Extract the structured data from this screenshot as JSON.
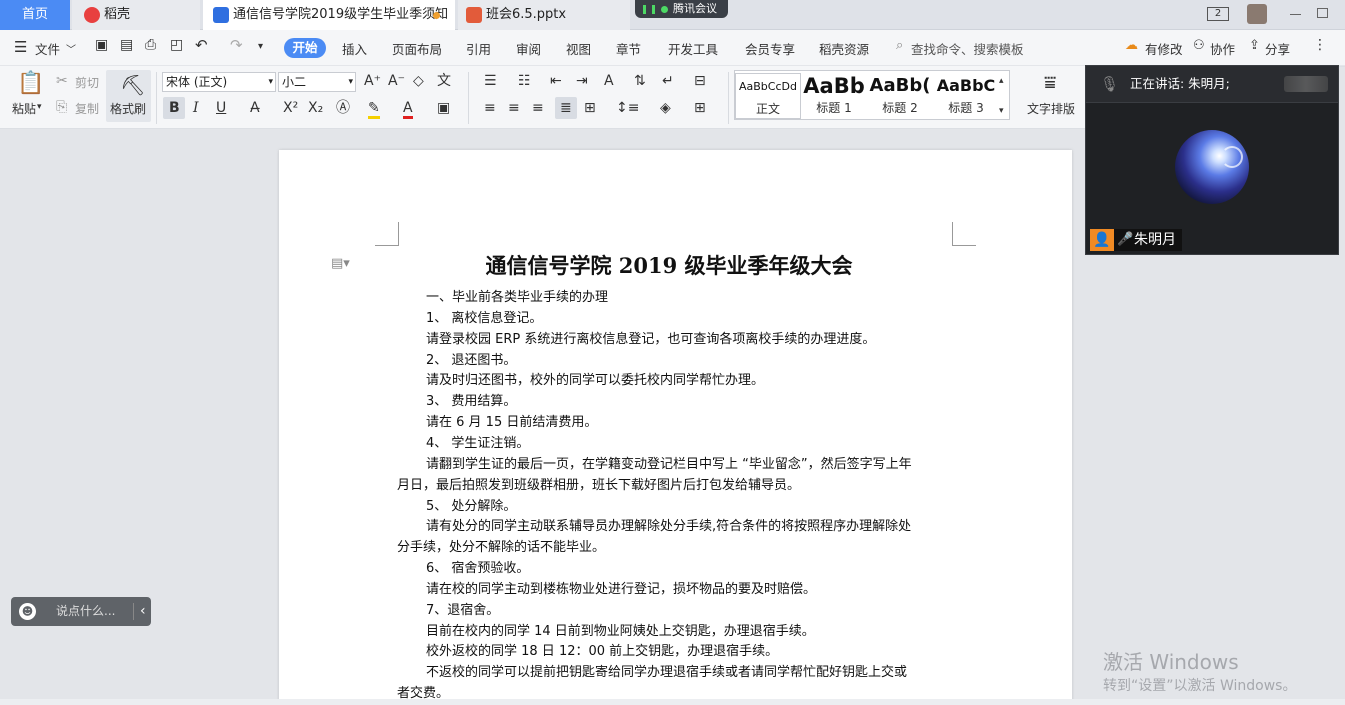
{
  "tabs": {
    "home": "首页",
    "daoke": "稻壳",
    "doc": "通信信号学院2019级学生毕业季须知",
    "ppt": "班会6.5.pptx"
  },
  "meeting_pill": "腾讯会议",
  "window": {
    "badge": "2"
  },
  "menu": {
    "file": "文件",
    "start": "开始",
    "items": [
      "插入",
      "页面布局",
      "引用",
      "审阅",
      "视图",
      "章节",
      "开发工具",
      "会员专享",
      "稻壳资源"
    ],
    "search": "查找命令、搜索模板",
    "has_changes": "有修改",
    "collab": "协作",
    "share": "分享"
  },
  "ribbon": {
    "paste": "粘贴",
    "cut": "剪切",
    "copy": "复制",
    "format_painter": "格式刷",
    "font_name": "宋体 (正文)",
    "font_size": "小二",
    "text_layout": "文字排版",
    "styles": [
      {
        "preview": "AaBbCcDd",
        "label": "正文"
      },
      {
        "preview": "AaBb",
        "label": "标题 1"
      },
      {
        "preview": "AaBb(",
        "label": "标题 2"
      },
      {
        "preview": "AaBbC",
        "label": "标题 3"
      }
    ]
  },
  "document": {
    "title": "通信信号学院 2019 级毕业季年级大会",
    "lines": [
      {
        "text": "一、毕业前各类毕业手续的办理",
        "indent": true
      },
      {
        "text": "1、 离校信息登记。",
        "indent": true
      },
      {
        "text": "请登录校园 ERP 系统进行离校信息登记，也可查询各项离校手续的办理进度。",
        "indent": true
      },
      {
        "text": "2、 退还图书。",
        "indent": true
      },
      {
        "text": "请及时归还图书，校外的同学可以委托校内同学帮忙办理。",
        "indent": true
      },
      {
        "text": "3、 费用结算。",
        "indent": true
      },
      {
        "text": "请在 6 月 15 日前结清费用。",
        "indent": true
      },
      {
        "text": "4、 学生证注销。",
        "indent": true
      },
      {
        "text": "请翻到学生证的最后一页，在学籍变动登记栏目中写上 “毕业留念”，然后签字写上年",
        "indent": true
      },
      {
        "text": "月日，最后拍照发到班级群相册，班长下载好图片后打包发给辅导员。",
        "indent": false
      },
      {
        "text": "5、 处分解除。",
        "indent": true
      },
      {
        "text": "请有处分的同学主动联系辅导员办理解除处分手续,符合条件的将按照程序办理解除处",
        "indent": true
      },
      {
        "text": "分手续，处分不解除的话不能毕业。",
        "indent": false
      },
      {
        "text": "6、 宿舍预验收。",
        "indent": true
      },
      {
        "text": "请在校的同学主动到楼栋物业处进行登记，损坏物品的要及时赔偿。",
        "indent": true
      },
      {
        "text": "7、退宿舍。",
        "indent": true
      },
      {
        "text": "目前在校内的同学 14 日前到物业阿姨处上交钥匙，办理退宿手续。",
        "indent": true
      },
      {
        "text": "校外返校的同学 18 日 12：00 前上交钥匙，办理退宿手续。",
        "indent": true
      },
      {
        "text": "不返校的同学可以提前把钥匙寄给同学办理退宿手续或者请同学帮忙配好钥匙上交或",
        "indent": true
      },
      {
        "text": "者交费。",
        "indent": false
      }
    ]
  },
  "meeting": {
    "speaking": "正在讲话: 朱明月;",
    "name": "朱明月"
  },
  "chat_placeholder": "说点什么...",
  "watermark": {
    "line1": "激活 Windows",
    "line2": "转到“设置”以激活 Windows。"
  },
  "colors": {
    "accent": "#4b8bf4",
    "meeting_orange": "#f08a24"
  }
}
